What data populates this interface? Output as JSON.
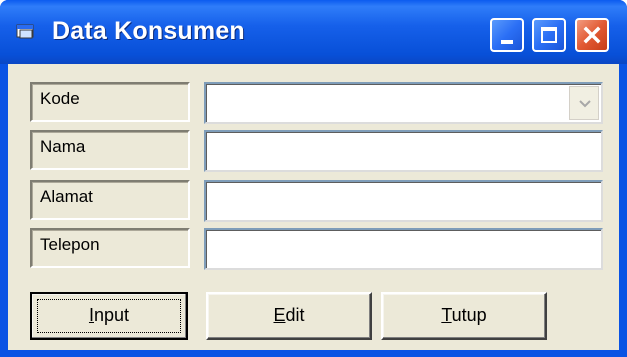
{
  "window": {
    "title": "Data Konsumen"
  },
  "fields": [
    {
      "label": "Kode",
      "value": "",
      "type": "combo"
    },
    {
      "label": "Nama",
      "value": "",
      "type": "text"
    },
    {
      "label": "Alamat",
      "value": "",
      "type": "text"
    },
    {
      "label": "Telepon",
      "value": "",
      "type": "text"
    }
  ],
  "buttons": {
    "input": {
      "accel": "I",
      "rest": "nput"
    },
    "edit": {
      "accel": "E",
      "rest": "dit"
    },
    "tutup": {
      "accel": "T",
      "rest": "utup"
    }
  },
  "colors": {
    "titlebar": "#0a53e4",
    "face": "#ece9d8",
    "close": "#e25a34"
  },
  "icons": [
    "app-icon",
    "minimize-icon",
    "maximize-icon",
    "close-icon",
    "dropdown-arrow-icon"
  ]
}
